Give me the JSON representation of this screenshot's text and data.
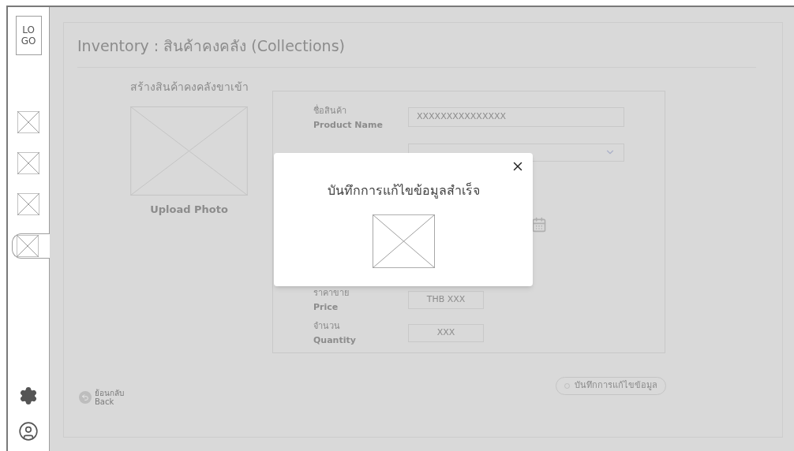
{
  "sidebar": {
    "logo": [
      "LO",
      "GO"
    ],
    "items": [
      {
        "selected": false
      },
      {
        "selected": false
      },
      {
        "selected": false
      },
      {
        "selected": true
      }
    ]
  },
  "page": {
    "title": "Inventory : สินค้าคงคลัง (Collections)",
    "subtitle": "สร้างสินค้าคงคลังขาเข้า",
    "upload_label": "Upload Photo"
  },
  "form": {
    "fields": [
      {
        "kind": "text",
        "label_th": "ชื่อสินค้า",
        "label_en": "Product Name",
        "value": "XXXXXXXXXXXXXXX"
      },
      {
        "kind": "select"
      },
      {
        "kind": "date"
      },
      {
        "kind": "short",
        "label_th": "ราคาขาย",
        "label_en": "Price",
        "value": "THB XXX"
      },
      {
        "kind": "short",
        "label_th": "จำนวน",
        "label_en": "Quantity",
        "value": "XXX"
      }
    ]
  },
  "back": {
    "label_th": "ย้อนกลับ",
    "label_en": "Back"
  },
  "save_button": "บันทึกการแก้ไขข้อมูล",
  "modal": {
    "title": "บันทึกการแก้ไขข้อมูลสำเร็จ"
  }
}
